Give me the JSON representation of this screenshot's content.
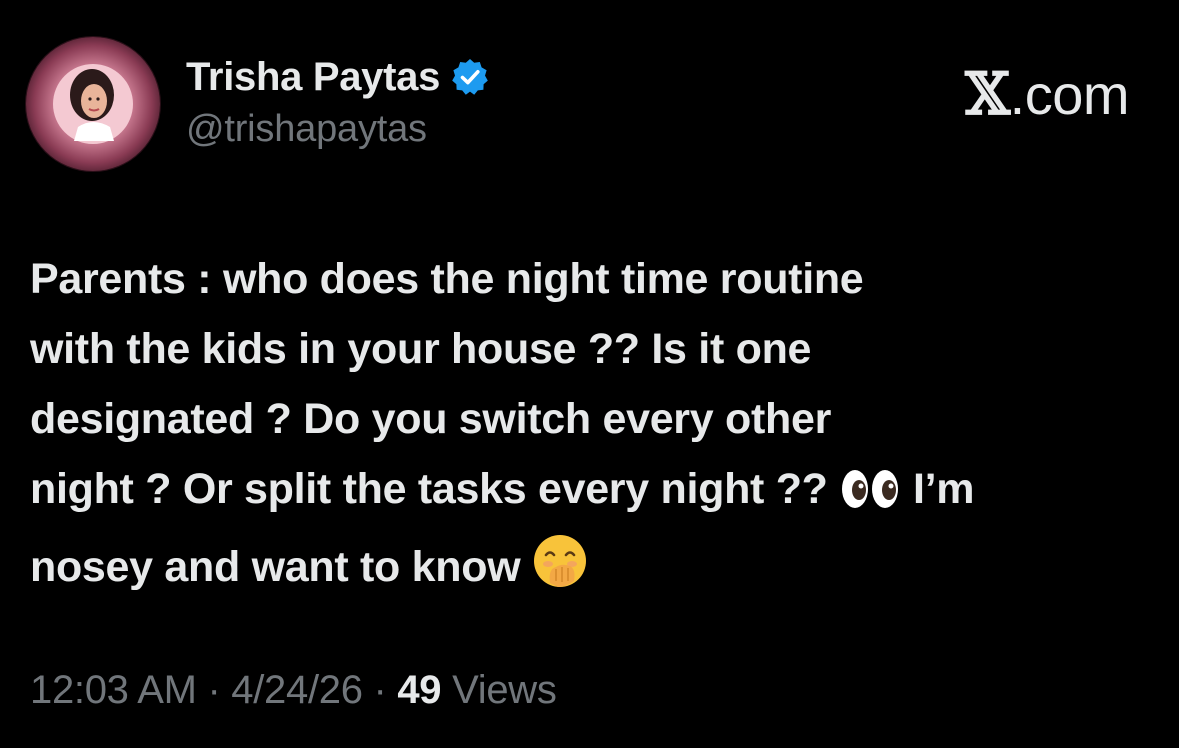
{
  "author": {
    "display_name": "Trisha Paytas",
    "handle": "@trishapaytas",
    "verified": true,
    "verified_badge_color": "#1d9bf0"
  },
  "watermark": {
    "x_mark": "𝕏",
    "domain": ".com"
  },
  "tweet": {
    "lines": [
      "Parents : who does the night time routine",
      "with the kids in your house ?? Is it one",
      "designated ? Do you switch every other",
      "night ? Or split the tasks every night ??",
      "I’m",
      "nosey and want to know"
    ],
    "emojis": [
      "eyes-emoji",
      "face-with-hand-over-mouth-emoji"
    ]
  },
  "meta": {
    "time": "12:03 AM",
    "separator": "·",
    "date": "4/24/26",
    "views_count": "49",
    "views_label": "Views"
  },
  "colors": {
    "background": "#000000",
    "primary_text": "#e7e9ea",
    "secondary_text": "#71767b",
    "accent": "#1d9bf0"
  }
}
